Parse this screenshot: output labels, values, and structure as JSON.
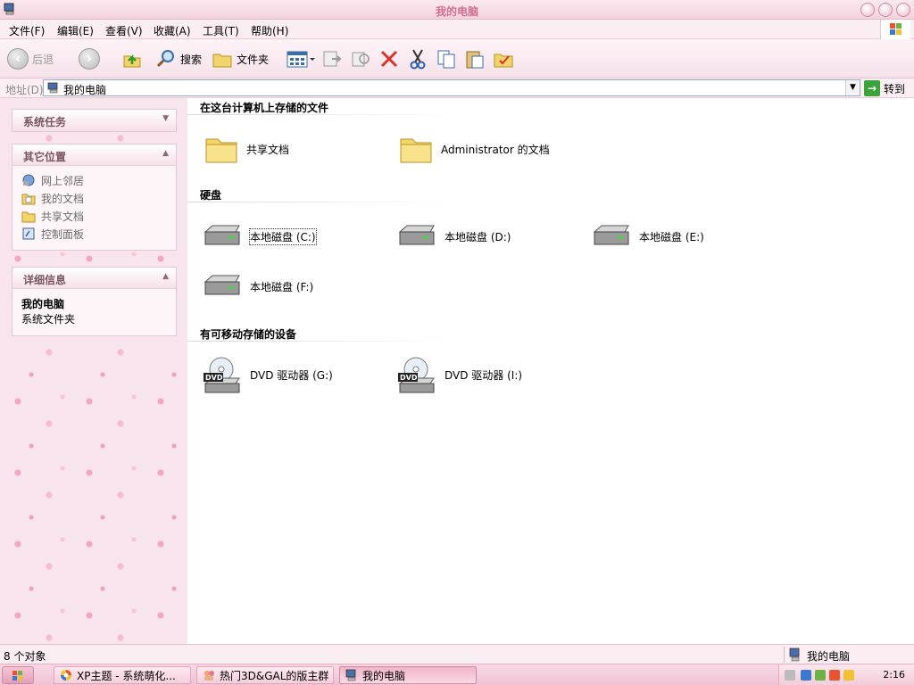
{
  "window": {
    "title": "我的电脑"
  },
  "menu": [
    "文件(F)",
    "编辑(E)",
    "查看(V)",
    "收藏(A)",
    "工具(T)",
    "帮助(H)"
  ],
  "toolbar": {
    "back_label": "后退",
    "search_label": "搜索",
    "folders_label": "文件夹"
  },
  "address": {
    "label": "地址(D)",
    "value": "我的电脑",
    "go_label": "转到"
  },
  "sidebar": {
    "system_tasks": {
      "title": "系统任务"
    },
    "other_places": {
      "title": "其它位置",
      "items": [
        "网上邻居",
        "我的文档",
        "共享文档",
        "控制面板"
      ]
    },
    "details": {
      "title": "详细信息",
      "name": "我的电脑",
      "type": "系统文件夹"
    }
  },
  "content": {
    "files_group": {
      "title": "在这台计算机上存储的文件",
      "items": [
        "共享文档",
        "Administrator 的文档"
      ]
    },
    "drives_group": {
      "title": "硬盘",
      "items": [
        "本地磁盘 (C:)",
        "本地磁盘 (D:)",
        "本地磁盘 (E:)",
        "本地磁盘 (F:)"
      ]
    },
    "removable_group": {
      "title": "有可移动存储的设备",
      "items": [
        "DVD 驱动器 (G:)",
        "DVD 驱动器 (I:)"
      ]
    }
  },
  "status": {
    "left": "8 个对象",
    "right": "我的电脑"
  },
  "taskbar": {
    "tasks": [
      "XP主题 - 系统萌化...",
      "热门3D&GAL的版主群",
      "我的电脑"
    ],
    "clock": "2:16"
  },
  "colors": {
    "title_text": "#d0708f",
    "accent_pink": "#f0b5c9",
    "go_green": "#3aa33c"
  }
}
